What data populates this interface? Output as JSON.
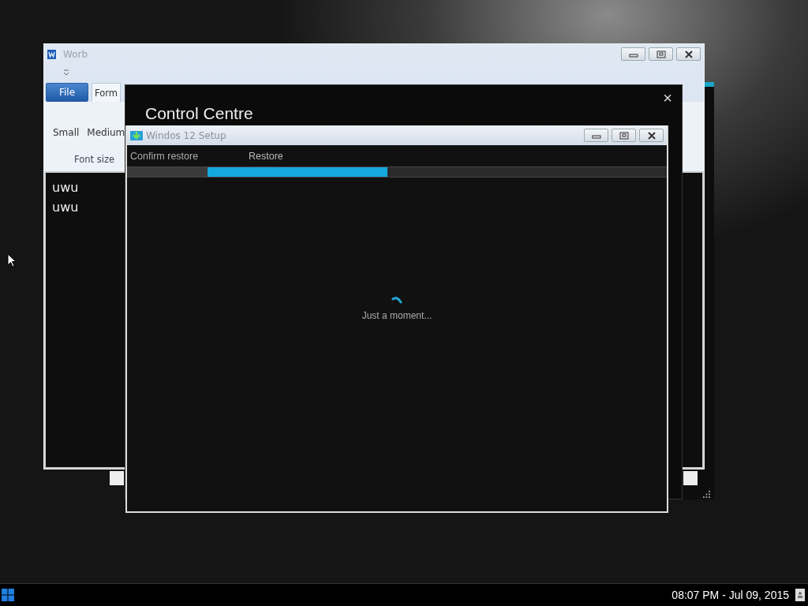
{
  "worb": {
    "title": "Worb",
    "file_button": "File",
    "tabs": [
      {
        "label": "Form",
        "selected": true
      }
    ],
    "ribbon": {
      "buttons": [
        "Small",
        "Medium"
      ],
      "group_label": "Font size"
    },
    "document": [
      "uwu",
      "uwu"
    ]
  },
  "control_centre": {
    "title": "Control Centre",
    "close": "×"
  },
  "setup": {
    "title": "Windos 12 Setup",
    "steps": [
      {
        "label": "Confirm restore",
        "selected": false
      },
      {
        "label": "Restore",
        "selected": true
      }
    ],
    "status": "Just a moment..."
  },
  "taskbar": {
    "clock": "08:07 PM - Jul 09, 2015"
  }
}
